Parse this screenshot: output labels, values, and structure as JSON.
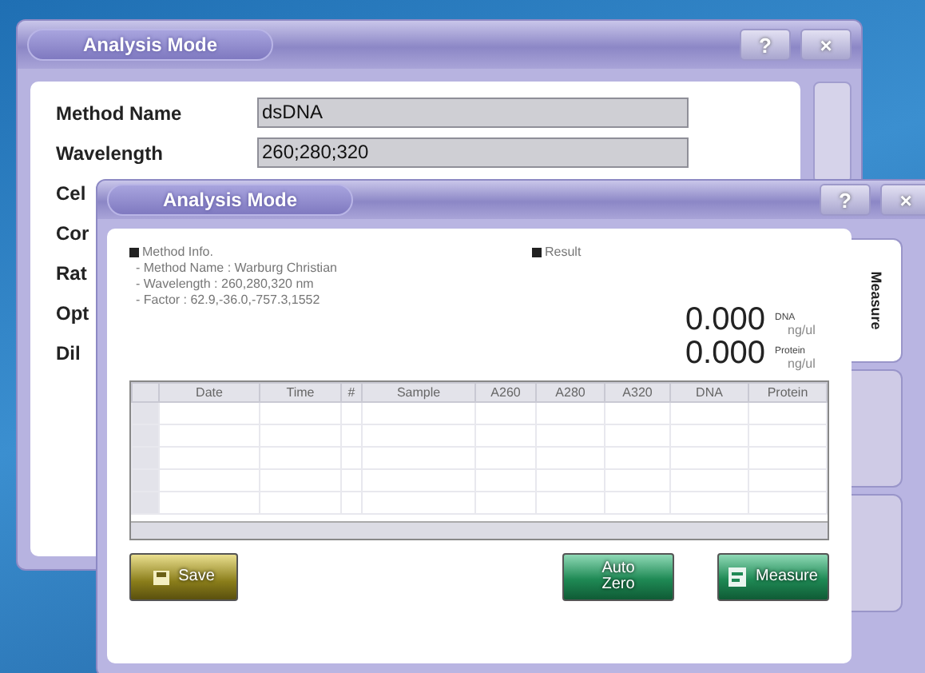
{
  "back_window": {
    "title": "Analysis Mode",
    "buttons": [
      "?",
      "×"
    ],
    "rows": [
      {
        "label": "Method Name",
        "value": "dsDNA"
      },
      {
        "label": "Wavelength",
        "value": "260;280;320"
      },
      {
        "label": "Cel"
      },
      {
        "label": "Cor"
      },
      {
        "label": "Rat"
      },
      {
        "label": "Opt"
      },
      {
        "label": "Dil"
      }
    ]
  },
  "front_window": {
    "title": "Analysis Mode",
    "buttons": [
      "?",
      "×"
    ],
    "method_info": {
      "heading": "Method Info.",
      "lines": [
        "- Method Name : Warburg Christian",
        "- Wavelength : 260,280,320 nm",
        "- Factor : 62.9,-36.0,-757.3,1552"
      ]
    },
    "result": {
      "heading": "Result",
      "readings": [
        {
          "value": "0.000",
          "name": "DNA",
          "unit": "ng/ul"
        },
        {
          "value": "0.000",
          "name": "Protein",
          "unit": "ng/ul"
        }
      ]
    },
    "table": {
      "columns": [
        "Date",
        "Time",
        "#",
        "Sample",
        "A260",
        "A280",
        "A320",
        "DNA",
        "Protein"
      ]
    },
    "actions": [
      {
        "label": "Save",
        "kind": "save"
      },
      {
        "label": "Auto Zero",
        "kind": "zero"
      },
      {
        "label": "Measure",
        "kind": "measure"
      }
    ],
    "side_tabs": [
      {
        "label": "Measure",
        "selected": true
      },
      {
        "selected": false
      },
      {
        "selected": false
      }
    ]
  }
}
